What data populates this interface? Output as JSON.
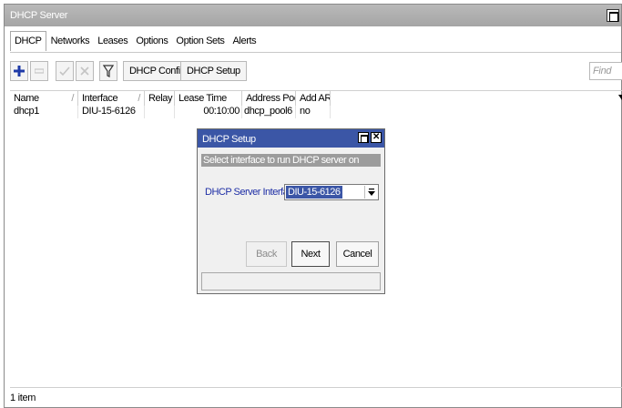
{
  "window": {
    "title": "DHCP Server"
  },
  "tabs": [
    "DHCP",
    "Networks",
    "Leases",
    "Options",
    "Option Sets",
    "Alerts"
  ],
  "toolbar": {
    "add_icon": "plus-icon",
    "remove_icon": "minus-icon",
    "enable_icon": "check-icon",
    "disable_icon": "cross-icon",
    "filter_icon": "filter-icon",
    "dhcp_config_label": "DHCP Config",
    "dhcp_setup_label": "DHCP Setup",
    "find_placeholder": "Find"
  },
  "table": {
    "columns": [
      "Name",
      "Interface",
      "Relay",
      "Lease Time",
      "Address Pool",
      "Add AR..."
    ],
    "rows": [
      {
        "name": "dhcp1",
        "interface": "DIU-15-6126",
        "relay": "",
        "lease_time": "00:10:00",
        "address_pool": "dhcp_pool6",
        "add_arp": "no"
      }
    ]
  },
  "status": {
    "items_text": "1 item"
  },
  "dialog": {
    "title": "DHCP Setup",
    "hint": "Select interface to run DHCP server on",
    "field_label": "DHCP Server Interface:",
    "field_value": "DIU-15-6126",
    "back_label": "Back",
    "next_label": "Next",
    "cancel_label": "Cancel",
    "accent_color": "#3b56a6"
  }
}
